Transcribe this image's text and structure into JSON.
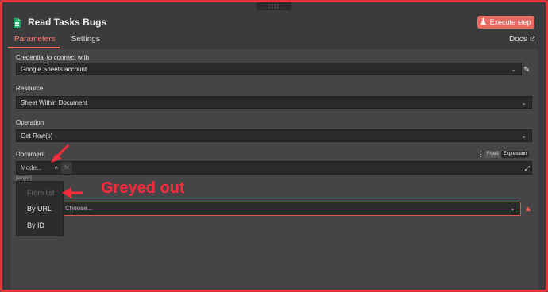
{
  "header": {
    "title": "Read Tasks Bugs",
    "execute_label": "Execute step",
    "drag_handle": "::::"
  },
  "tabs": [
    {
      "label": "Parameters",
      "active": true
    },
    {
      "label": "Settings",
      "active": false
    }
  ],
  "docs_label": "Docs",
  "fields": {
    "credential": {
      "label": "Credential to connect with",
      "value": "Google Sheets account"
    },
    "resource": {
      "label": "Resource",
      "value": "Sheet Within Document"
    },
    "operation": {
      "label": "Operation",
      "value": "Get Row(s)"
    },
    "document": {
      "label": "Document",
      "mode_placeholder": "Mode...",
      "fx_label": "fx",
      "empty_hint": "[empty]",
      "choose_placeholder": "Choose...",
      "toggle": {
        "fixed": "Fixed",
        "expression": "Expression",
        "active": "expression"
      }
    }
  },
  "mode_dropdown": {
    "options": [
      {
        "label": "From list",
        "disabled": true
      },
      {
        "label": "By URL",
        "disabled": false
      },
      {
        "label": "By ID",
        "disabled": false
      }
    ]
  },
  "annotation": {
    "text": "Greyed out",
    "color": "#ff2a3a"
  },
  "colors": {
    "accent": "#ff6d5a",
    "execute_bg": "#ea6a62",
    "frame": "#e8323c"
  }
}
